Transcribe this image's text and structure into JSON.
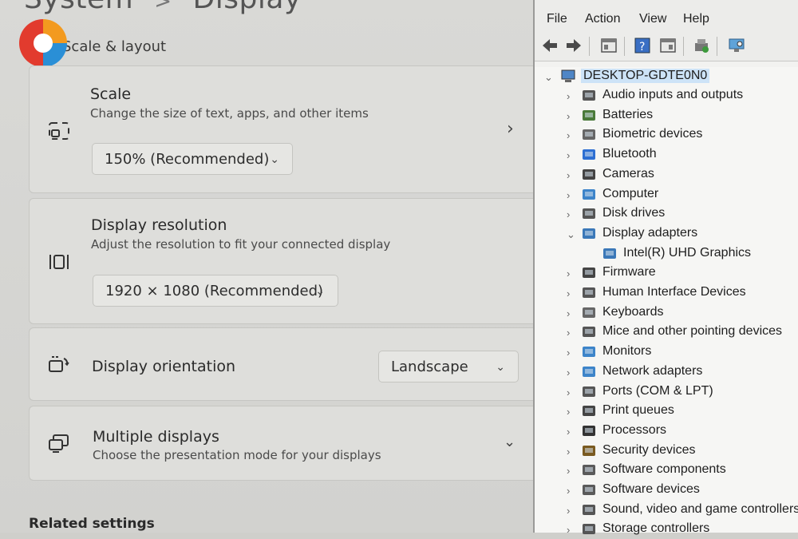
{
  "settings": {
    "breadcrumb": {
      "parent": "System",
      "separator": ">",
      "current": "Display"
    },
    "section_title": "Scale & layout",
    "scale": {
      "title": "Scale",
      "subtitle": "Change the size of text, apps, and other items",
      "value": "150% (Recommended)"
    },
    "resolution": {
      "title": "Display resolution",
      "subtitle": "Adjust the resolution to fit your connected display",
      "value": "1920 × 1080 (Recommended)"
    },
    "orientation": {
      "title": "Display orientation",
      "value": "Landscape"
    },
    "multiple": {
      "title": "Multiple displays",
      "subtitle": "Choose the presentation mode for your displays"
    },
    "related_settings": "Related settings"
  },
  "device_manager": {
    "menu": [
      "File",
      "Action",
      "View",
      "Help"
    ],
    "root": "DESKTOP-GDTE0N0",
    "categories": [
      {
        "label": "Audio inputs and outputs",
        "icon": "speaker-icon"
      },
      {
        "label": "Batteries",
        "icon": "battery-icon"
      },
      {
        "label": "Biometric devices",
        "icon": "biometric-icon"
      },
      {
        "label": "Bluetooth",
        "icon": "bluetooth-icon"
      },
      {
        "label": "Cameras",
        "icon": "camera-icon"
      },
      {
        "label": "Computer",
        "icon": "computer-icon"
      },
      {
        "label": "Disk drives",
        "icon": "disk-icon"
      },
      {
        "label": "Display adapters",
        "icon": "display-adapter-icon",
        "expanded": true
      },
      {
        "label": "Intel(R) UHD Graphics",
        "icon": "display-adapter-icon",
        "child": true
      },
      {
        "label": "Firmware",
        "icon": "chip-icon"
      },
      {
        "label": "Human Interface Devices",
        "icon": "hid-icon"
      },
      {
        "label": "Keyboards",
        "icon": "keyboard-icon"
      },
      {
        "label": "Mice and other pointing devices",
        "icon": "mouse-icon"
      },
      {
        "label": "Monitors",
        "icon": "monitor-icon"
      },
      {
        "label": "Network adapters",
        "icon": "network-icon"
      },
      {
        "label": "Ports (COM & LPT)",
        "icon": "port-icon"
      },
      {
        "label": "Print queues",
        "icon": "printer-icon"
      },
      {
        "label": "Processors",
        "icon": "processor-icon"
      },
      {
        "label": "Security devices",
        "icon": "security-icon"
      },
      {
        "label": "Software components",
        "icon": "software-component-icon"
      },
      {
        "label": "Software devices",
        "icon": "software-device-icon"
      },
      {
        "label": "Sound, video and game controllers",
        "icon": "sound-icon"
      },
      {
        "label": "Storage controllers",
        "icon": "storage-icon"
      }
    ]
  }
}
